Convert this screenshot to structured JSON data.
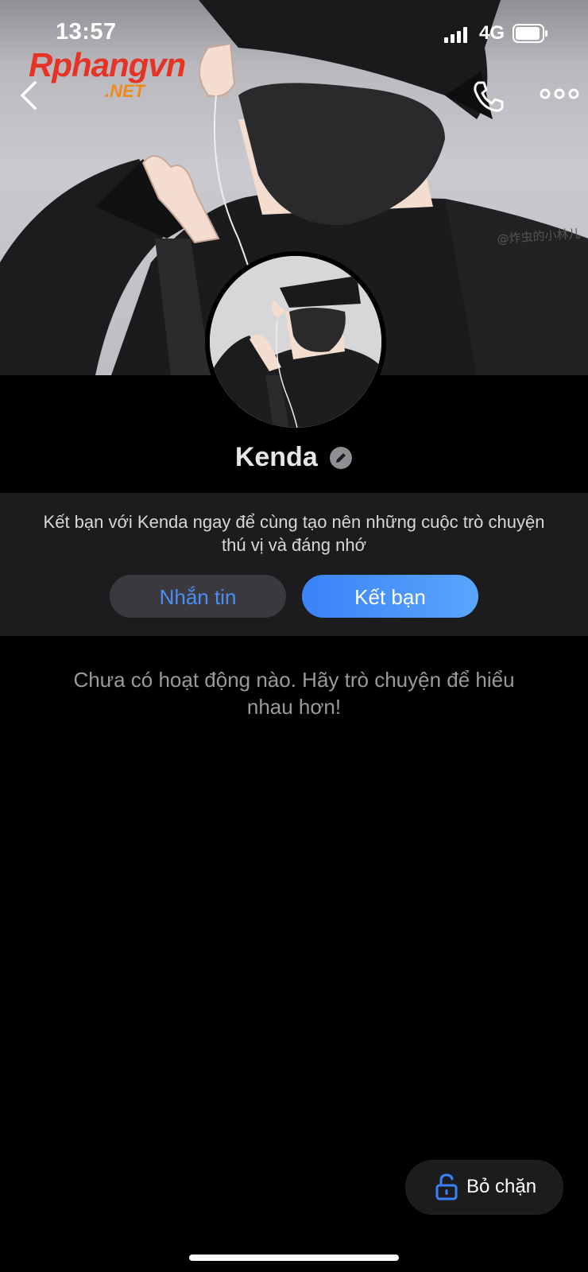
{
  "status_bar": {
    "time": "13:57",
    "network": "4G"
  },
  "watermark_logo": {
    "main": "Rphangvn",
    "sub": ".NET"
  },
  "cover_watermark": "@炸虫的小林儿",
  "header": {
    "back_icon": "chevron-left-icon",
    "call_icon": "phone-icon",
    "more_icon": "ellipsis-icon"
  },
  "profile": {
    "name": "Kenda"
  },
  "invite": {
    "text": "Kết bạn với Kenda ngay để cùng tạo nên những cuộc trò chuyện thú vị và đáng nhớ",
    "message_label": "Nhắn tin",
    "add_friend_label": "Kết bạn"
  },
  "activity": {
    "empty_text": "Chưa có hoạt động nào. Hãy trò chuyện để hiểu nhau hơn!"
  },
  "unblock": {
    "label": "Bỏ chặn",
    "icon": "unlock-icon"
  },
  "colors": {
    "accent": "#3a82f7",
    "panel": "#1c1c1e",
    "background": "#000000"
  }
}
